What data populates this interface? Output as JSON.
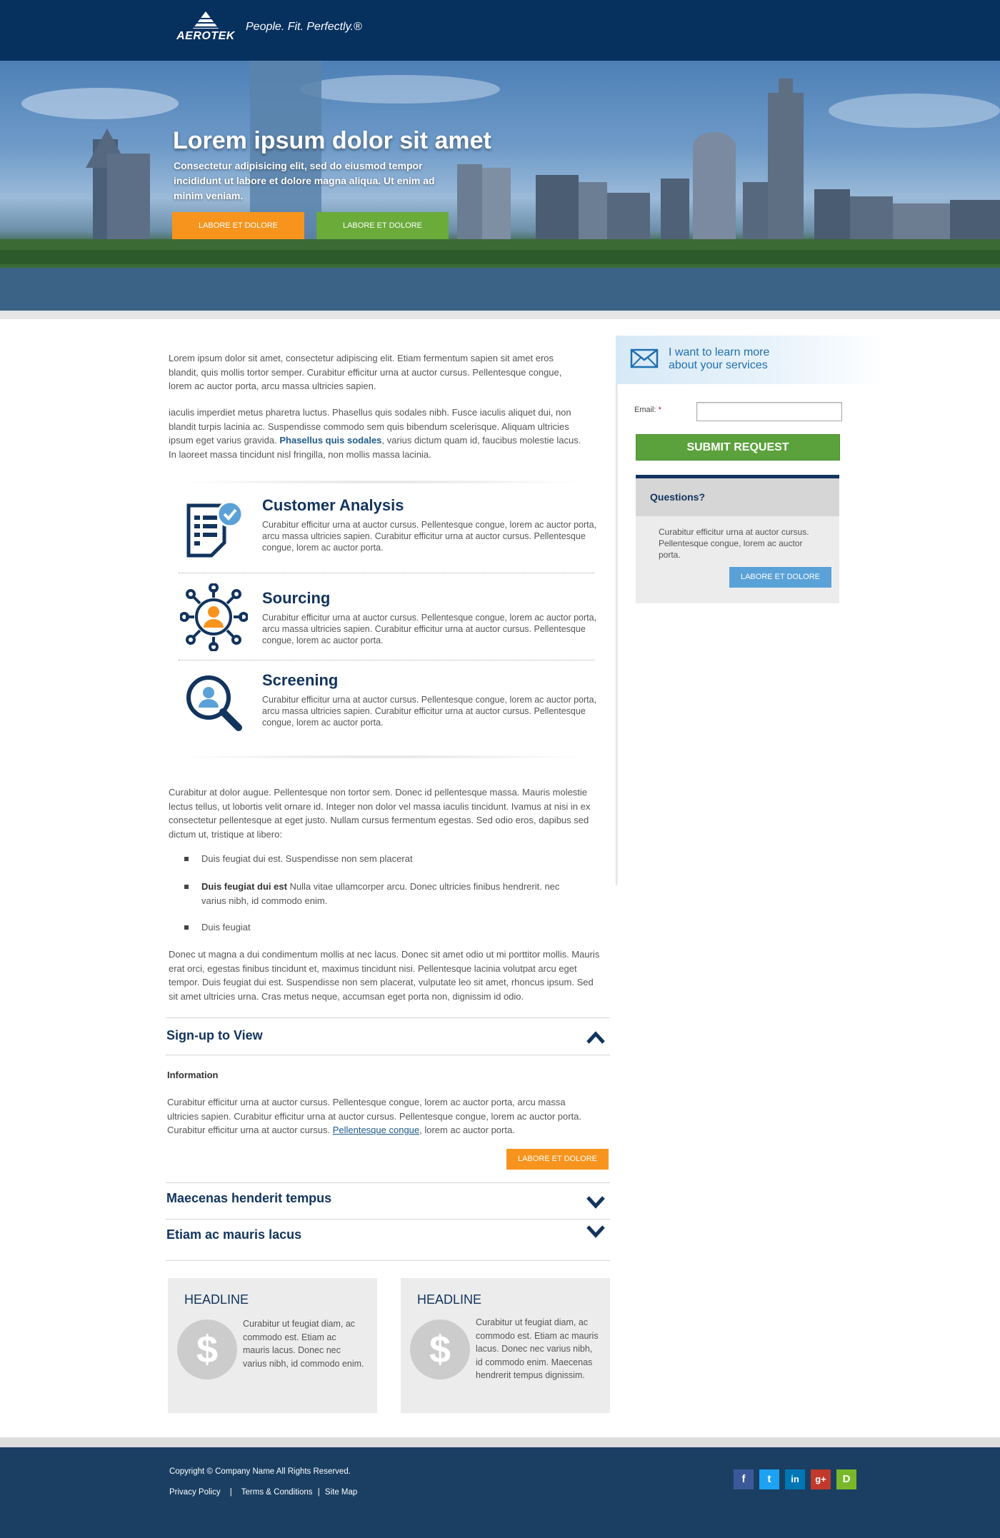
{
  "header": {
    "logo_text": "AEROTEK",
    "tagline": "People. Fit. Perfectly.®"
  },
  "hero": {
    "title": "Lorem ipsum dolor sit amet",
    "subtitle": "Consectetur adipisicing elit, sed do eiusmod tempor incididunt ut labore et dolore magna aliqua. Ut enim ad minim veniam.",
    "button_primary": "LABORE ET DOLORE",
    "button_secondary": "LABORE ET DOLORE"
  },
  "intro": {
    "p1": "Lorem ipsum dolor sit amet, consectetur adipiscing elit. Etiam fermentum sapien sit amet eros blandit, quis mollis tortor semper. Curabitur efficitur urna at auctor cursus. Pellentesque congue, lorem ac auctor porta, arcu massa ultricies sapien.",
    "p2_before": "iaculis imperdiet metus pharetra luctus. Phasellus quis sodales nibh. Fusce iaculis aliquet dui, non blandit turpis lacinia ac. Suspendisse commodo sem quis bibendum scelerisque. Aliquam ultricies ipsum eget varius gravida. ",
    "p2_link": "Phasellus quis sodales",
    "p2_after": ", varius dictum quam id, faucibus molestie lacus. In laoreet massa tincidunt nisl fringilla, non mollis massa lacinia."
  },
  "services": [
    {
      "title": "Customer Analysis",
      "icon": "checklist-icon",
      "desc": "Curabitur efficitur urna at auctor cursus. Pellentesque congue, lorem ac auctor porta, arcu massa ultricies sapien. Curabitur efficitur urna at auctor cursus. Pellentesque congue, lorem ac auctor porta."
    },
    {
      "title": "Sourcing",
      "icon": "network-person-icon",
      "desc": "Curabitur efficitur urna at auctor cursus. Pellentesque congue, lorem ac auctor porta, arcu massa ultricies sapien. Curabitur efficitur urna at auctor cursus. Pellentesque congue, lorem ac auctor porta."
    },
    {
      "title": "Screening",
      "icon": "magnifier-person-icon",
      "desc": "Curabitur efficitur urna at auctor cursus. Pellentesque congue, lorem ac auctor porta, arcu massa ultricies sapien. Curabitur efficitur urna at auctor cursus. Pellentesque congue, lorem ac auctor porta."
    }
  ],
  "body": {
    "p3": "Curabitur at dolor augue. Pellentesque non tortor sem. Donec id pellentesque massa. Mauris molestie lectus tellus, ut lobortis velit ornare id. Integer non dolor vel massa iaculis tincidunt. Ivamus at nisi in ex consectetur pellentesque at eget justo. Nullam cursus fermentum egestas. Sed odio eros, dapibus sed dictum ut, tristique at libero:",
    "bullets": [
      {
        "bold": "",
        "text": "Duis feugiat dui est. Suspendisse non sem placerat"
      },
      {
        "bold": "Duis feugiat dui est",
        "text": " Nulla vitae ullamcorper arcu. Donec ultricies finibus hendrerit. nec varius nibh, id commodo enim."
      },
      {
        "bold": "",
        "text": "Duis feugiat"
      }
    ],
    "p4": "Donec ut magna a dui condimentum mollis at nec lacus. Donec sit amet odio ut mi porttitor mollis. Mauris erat orci, egestas finibus tincidunt et, maximus tincidunt nisi. Pellentesque lacinia volutpat arcu eget tempor. Duis feugiat dui est. Suspendisse non sem placerat, vulputate leo sit amet, rhoncus ipsum. Sed sit amet ultricies urna. Cras metus neque, accumsan eget porta non, dignissim id odio."
  },
  "accordion": {
    "open": {
      "title": "Sign-up to View",
      "subheading": "Information",
      "text_before": "Curabitur efficitur urna at auctor cursus. Pellentesque congue, lorem ac auctor porta, arcu massa ultricies sapien. Curabitur efficitur urna at auctor cursus. Pellentesque congue, lorem ac auctor porta. Curabitur efficitur urna at auctor cursus. ",
      "text_link": "Pellentesque congue",
      "text_after": ", lorem ac auctor porta.",
      "button": "LABORE ET DOLORE"
    },
    "closed": [
      {
        "title": "Maecenas henderit tempus"
      },
      {
        "title": "Etiam ac mauris lacus"
      }
    ]
  },
  "cards": [
    {
      "headline": "HEADLINE",
      "icon": "dollar-icon",
      "text": "Curabitur ut feugiat diam, ac commodo est. Etiam ac mauris lacus. Donec nec varius nibh, id commodo enim."
    },
    {
      "headline": "HEADLINE",
      "icon": "dollar-icon",
      "text": "Curabitur ut feugiat diam, ac commodo est. Etiam ac mauris lacus. Donec nec varius nibh, id commodo enim. Maecenas hendrerit tempus dignissim."
    }
  ],
  "sidebar": {
    "learn_more": "I want to learn more about your services",
    "email_label": "Email:",
    "required_mark": "*",
    "email_value": "",
    "submit": "SUBMIT REQUEST",
    "questions_title": "Questions?",
    "questions_text": "Curabitur efficitur urna at auctor cursus. Pellentesque congue, lorem ac auctor porta.",
    "questions_button": "LABORE ET DOLORE"
  },
  "footer": {
    "copyright": "Copyright © Company Name All Rights Reserved.",
    "links": [
      "Privacy Policy",
      "Terms & Conditions",
      "Site Map"
    ],
    "separators": [
      "|",
      "|"
    ],
    "social": [
      {
        "name": "facebook-icon",
        "label": "f",
        "color": "#3b5998"
      },
      {
        "name": "twitter-icon",
        "label": "t",
        "color": "#1da1f2"
      },
      {
        "name": "linkedin-icon",
        "label": "in",
        "color": "#0077b5"
      },
      {
        "name": "google-plus-icon",
        "label": "g+",
        "color": "#c1392b"
      },
      {
        "name": "glassdoor-icon",
        "label": "D",
        "color": "#7ab829"
      }
    ]
  },
  "colors": {
    "navy": "#06305e",
    "accent_orange": "#f7941d",
    "accent_green": "#6aab3a",
    "accent_blue": "#5aa1d7",
    "footer_bg": "#1a3f63"
  }
}
